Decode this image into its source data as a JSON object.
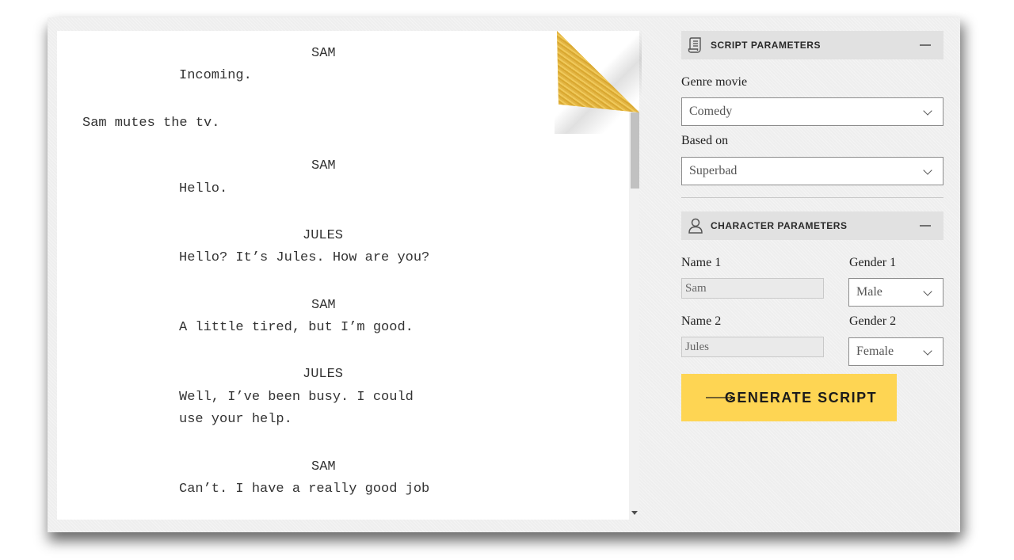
{
  "script": {
    "lines": [
      "SAM",
      "Incoming.",
      "Sam mutes the tv.",
      "SAM",
      "Hello.",
      "JULES",
      "Hello? It’s Jules. How are you?",
      "SAM",
      "A little tired, but I’m good.",
      "JULES",
      "Well, I’ve been busy. I could",
      "use your help.",
      "SAM",
      "Can’t. I have a really good job"
    ]
  },
  "script_params": {
    "title": "SCRIPT PARAMETERS",
    "genre_label": "Genre movie",
    "genre_value": "Comedy",
    "based_on_label": "Based on",
    "based_on_value": "Superbad"
  },
  "character_params": {
    "title": "CHARACTER PARAMETERS",
    "name1_label": "Name 1",
    "name1_value": "Sam",
    "gender1_label": "Gender 1",
    "gender1_value": "Male",
    "name2_label": "Name 2",
    "name2_value": "Jules",
    "gender2_label": "Gender 2",
    "gender2_value": "Female"
  },
  "generate_button": {
    "label": "GENERATE SCRIPT"
  },
  "icons": {
    "script_section": "scroll-document-icon",
    "character_section": "user-icon",
    "collapse": "minus-icon",
    "button": "arrow-right-icon"
  },
  "colors": {
    "accent": "#fed553",
    "gold": "#e6b843"
  }
}
